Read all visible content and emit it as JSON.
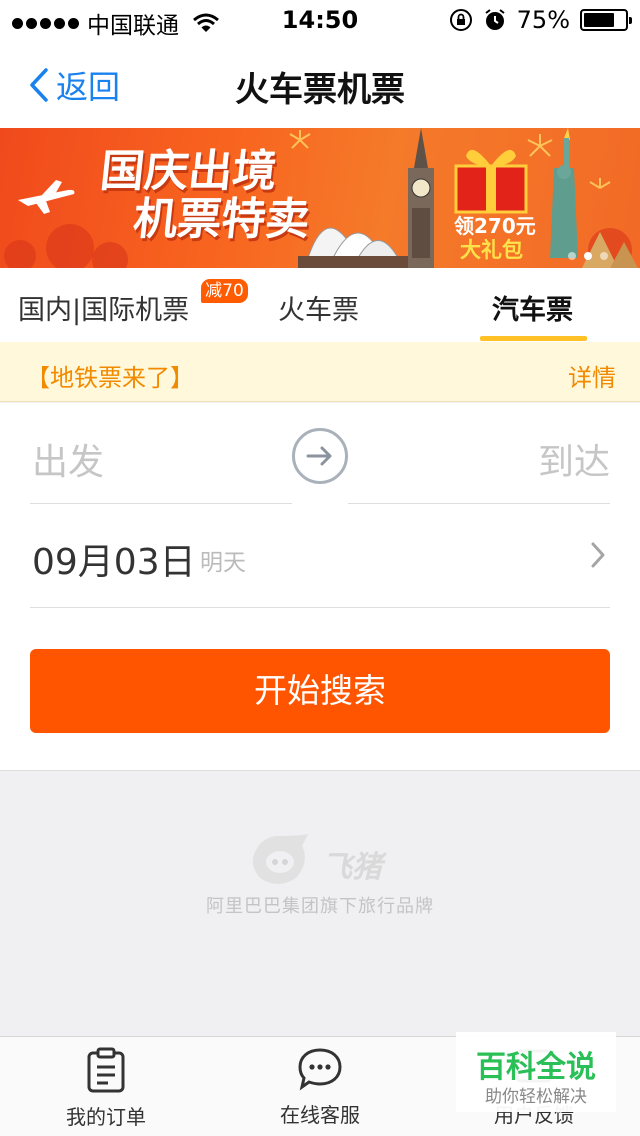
{
  "status_bar": {
    "carrier": "中国联通",
    "time": "14:50",
    "battery": "75%",
    "battery_level": 0.75
  },
  "nav": {
    "back_label": "返回",
    "title": "火车票机票"
  },
  "banner": {
    "headline_line1": "国庆出境",
    "headline_line2": "机票特卖",
    "gift_line1": "领270元",
    "gift_line2": "大礼包",
    "page_count": 3,
    "active_page": 1
  },
  "tabs": {
    "items": [
      {
        "label": "国内|国际机票"
      },
      {
        "label": "火车票"
      },
      {
        "label": "汽车票"
      }
    ],
    "badge": "减70",
    "active_index": 2
  },
  "notice": {
    "text": "【地铁票来了】",
    "detail_label": "详情"
  },
  "form": {
    "from_placeholder": "出发",
    "to_placeholder": "到达",
    "date": "09月03日",
    "date_tag": "明天",
    "search_label": "开始搜索"
  },
  "brand": {
    "name": "飞猪",
    "subtitle": "阿里巴巴集团旗下旅行品牌"
  },
  "bottom_bar": {
    "items": [
      {
        "label": "我的订单",
        "icon": "clipboard-icon"
      },
      {
        "label": "在线客服",
        "icon": "chat-icon"
      },
      {
        "label": "用户反馈",
        "icon": "feedback-icon"
      }
    ]
  },
  "watermark": {
    "title": "百科全说",
    "subtitle": "助你轻松解决"
  },
  "colors": {
    "accent_blue": "#1a82ef",
    "primary_orange": "#ff5500",
    "tab_underline": "#ffc125",
    "notice_text": "#f28a00"
  }
}
